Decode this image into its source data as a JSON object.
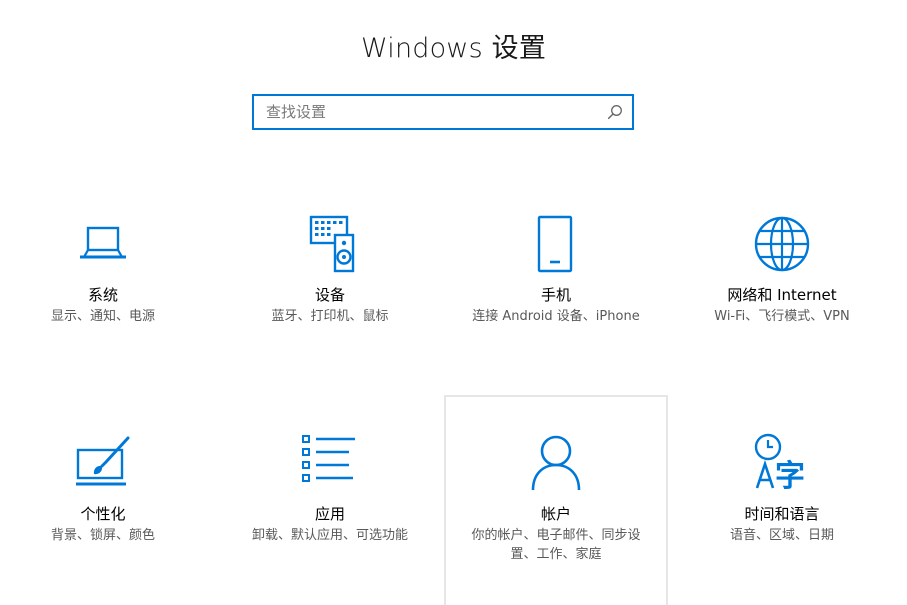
{
  "window": {
    "title": "Windows 设置"
  },
  "search": {
    "placeholder": "查找设置",
    "value": "",
    "icon": "search-icon"
  },
  "colors": {
    "accent": "#0078d7",
    "hover_border": "#e6e6e6",
    "description": "#595959"
  },
  "tiles": [
    {
      "name": "系统",
      "description": "显示、通知、电源",
      "icon": "laptop-icon"
    },
    {
      "name": "设备",
      "description": "蓝牙、打印机、鼠标",
      "icon": "keyboard-speaker-icon"
    },
    {
      "name": "手机",
      "description": "连接 Android 设备、iPhone",
      "icon": "phone-icon"
    },
    {
      "name": "网络和 Internet",
      "description": "Wi-Fi、飞行模式、VPN",
      "icon": "globe-icon"
    },
    {
      "name": "个性化",
      "description": "背景、锁屏、颜色",
      "icon": "paint-brush-icon"
    },
    {
      "name": "应用",
      "description": "卸载、默认应用、可选功能",
      "icon": "apps-list-icon"
    },
    {
      "name": "帐户",
      "description": "你的帐户、电子邮件、同步设置、工作、家庭",
      "icon": "person-icon"
    },
    {
      "name": "时间和语言",
      "description": "语音、区域、日期",
      "icon": "clock-language-icon"
    }
  ]
}
